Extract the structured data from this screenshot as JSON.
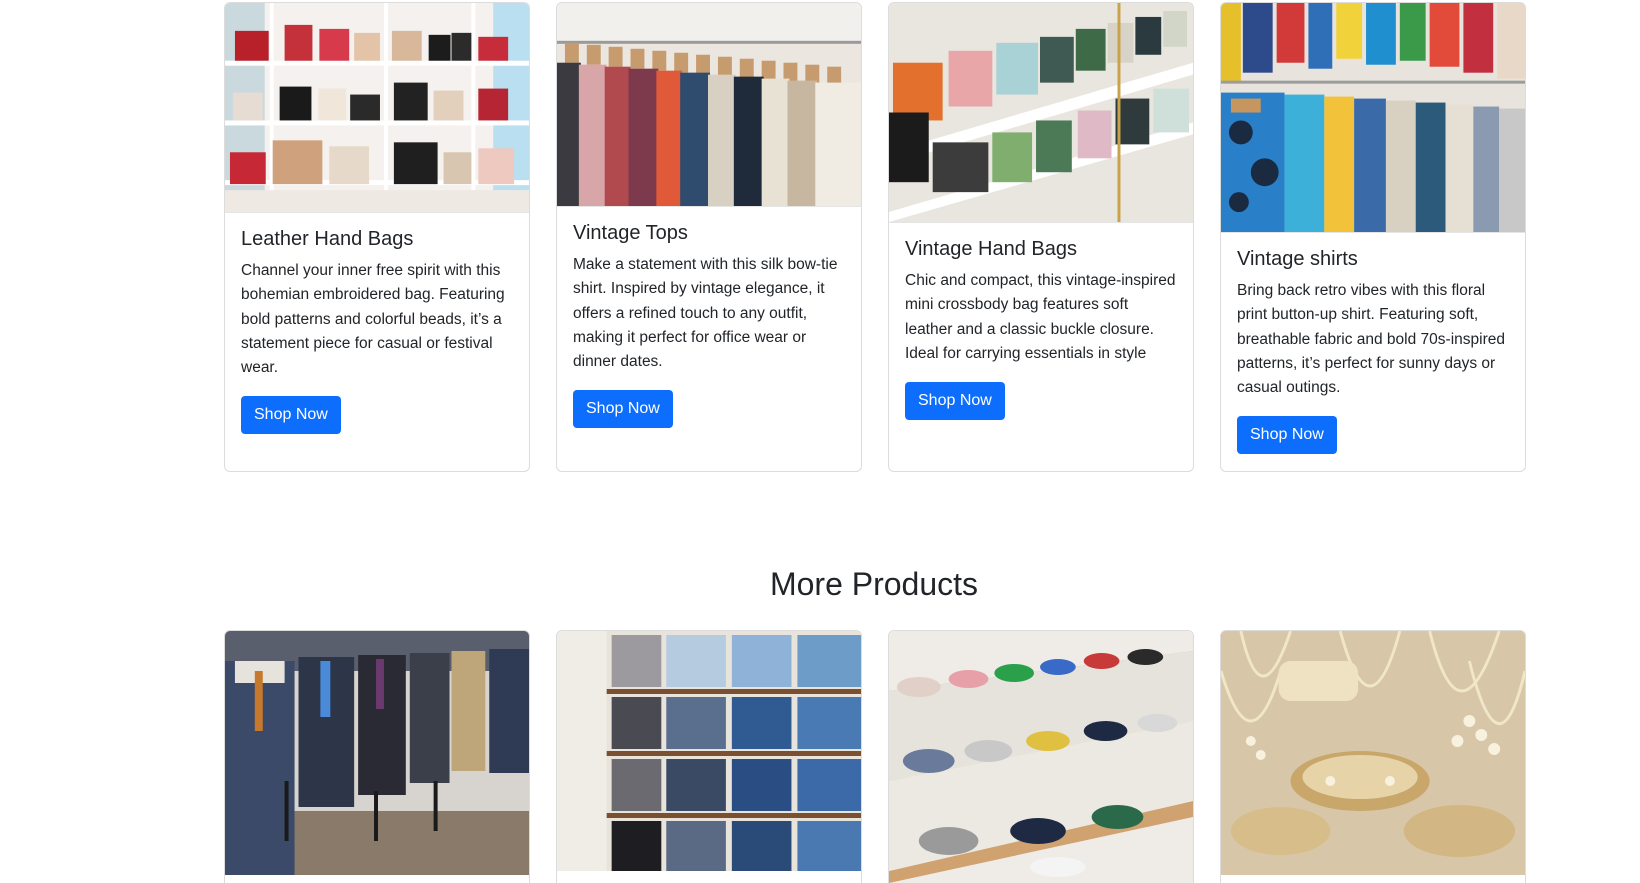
{
  "row1_cards": [
    {
      "title": "Leather Hand Bags",
      "text": "Channel your inner free spirit with this bohemian embroidered bag. Featuring bold patterns and colorful beads, it’s a statement piece for casual or festival wear.",
      "button": "Shop Now",
      "image_icon": "handbag-shelf-photo"
    },
    {
      "title": "Vintage Tops",
      "text": "Make a statement with this silk bow-tie shirt. Inspired by vintage elegance, it offers a refined touch to any outfit, making it perfect for office wear or dinner dates.",
      "button": "Shop Now",
      "image_icon": "clothing-rack-photo"
    },
    {
      "title": "Vintage Hand Bags",
      "text": "Chic and compact, this vintage-inspired mini crossbody bag features soft leather and a classic buckle closure. Ideal for carrying essentials in style",
      "button": "Shop Now",
      "image_icon": "handbag-display-photo"
    },
    {
      "title": "Vintage shirts",
      "text": "Bring back retro vibes with this floral print button-up shirt. Featuring soft, breathable fabric and bold 70s-inspired patterns, it’s perfect for sunny days or casual outings.",
      "button": "Shop Now",
      "image_icon": "shirt-rack-photo"
    }
  ],
  "section": {
    "title": "More Products"
  },
  "row2_cards": [
    {
      "image_icon": "suits-mannequins-photo"
    },
    {
      "image_icon": "jeans-shelf-photo"
    },
    {
      "image_icon": "sneakers-shelf-photo"
    },
    {
      "image_icon": "jewelry-display-photo"
    }
  ],
  "colors": {
    "button_bg": "#0d6efd",
    "button_text": "#ffffff",
    "card_border": "#dcdcdc",
    "text": "#212529"
  }
}
